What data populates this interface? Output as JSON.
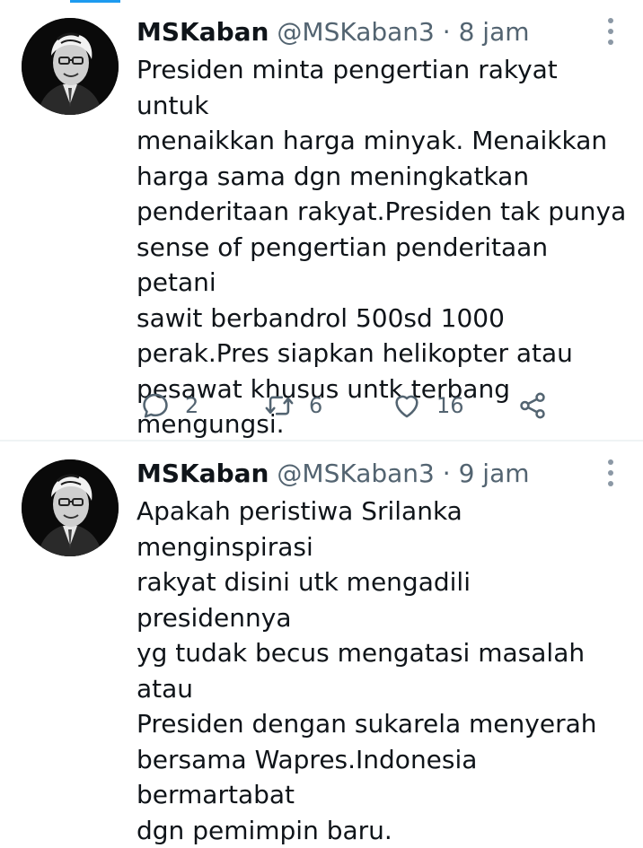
{
  "tweets": [
    {
      "display_name": "MSKaban",
      "handle": "@MSKaban3",
      "separator": "·",
      "time": "8 jam",
      "text": "Presiden minta pengertian rakyat untuk\nmenaikkan harga minyak. Menaikkan\nharga sama dgn meningkatkan\npenderitaan rakyat.Presiden tak punya\nsense of pengertian penderitaan petani\nsawit berbandrol 500sd 1000\nperak.Pres siapkan helikopter atau\npesawat khusus untk terbang\nmengungsi.",
      "reply_count": "2",
      "retweet_count": "6",
      "like_count": "16"
    },
    {
      "display_name": "MSKaban",
      "handle": "@MSKaban3",
      "separator": "·",
      "time": "9 jam",
      "text": "Apakah peristiwa Srilanka menginspirasi\nrakyat disini utk mengadili presidennya\nyg tudak becus mengatasi masalah atau\nPresiden dengan sukarela menyerah\nbersama Wapres.Indonesia bermartabat\ndgn pemimpin baru."
    }
  ],
  "colors": {
    "accent": "#1d9bf0",
    "text": "#0f1419",
    "secondary": "#536471",
    "divider": "#eff3f4"
  },
  "icons": [
    "reply-icon",
    "retweet-icon",
    "like-icon",
    "share-icon",
    "more-icon"
  ]
}
